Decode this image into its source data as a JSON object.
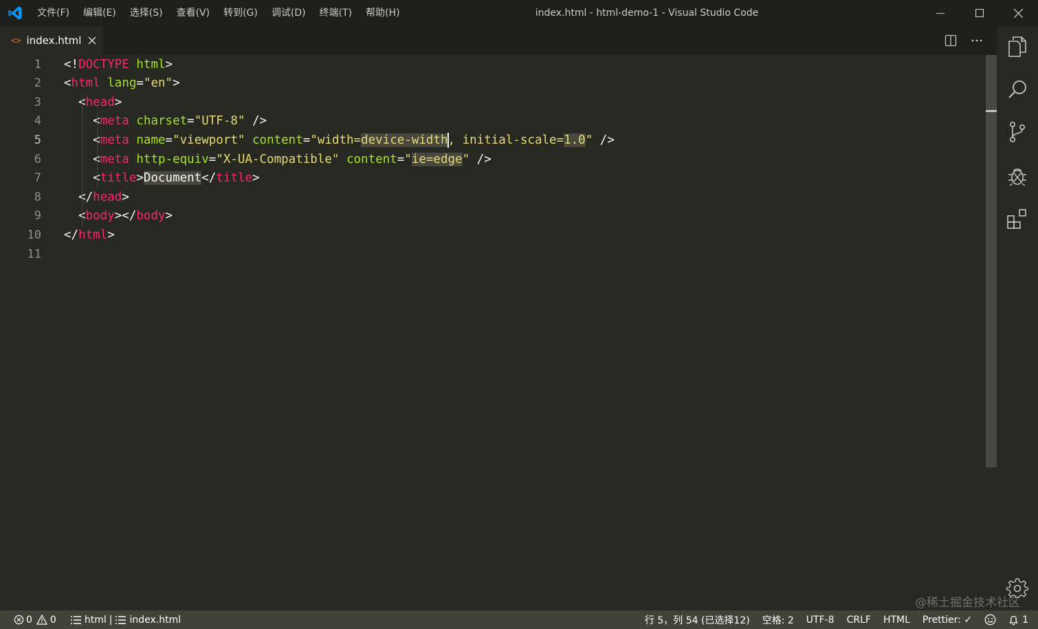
{
  "window": {
    "title": "index.html - html-demo-1 - Visual Studio Code",
    "logo_icon": "vscode-logo-icon",
    "accent": "#0098ff",
    "controls": [
      "minimize-icon",
      "maximize-icon",
      "close-icon"
    ]
  },
  "menu": [
    "文件(F)",
    "编辑(E)",
    "选择(S)",
    "查看(V)",
    "转到(G)",
    "调试(D)",
    "终端(T)",
    "帮助(H)"
  ],
  "tabs": [
    {
      "label": "index.html",
      "icon": "html-file-icon",
      "icon_glyph": "<>",
      "active": true,
      "close_icon": "close-icon"
    }
  ],
  "editor_actions": [
    "split-editor-icon",
    "more-actions-icon"
  ],
  "editor": {
    "active_line": 5,
    "line_numbers": [
      "1",
      "2",
      "3",
      "4",
      "5",
      "6",
      "7",
      "8",
      "9",
      "10",
      "11"
    ],
    "lines": [
      [
        [
          "p",
          "<!"
        ],
        [
          "tag",
          "DOCTYPE"
        ],
        [
          "p",
          " "
        ],
        [
          "attr",
          "html"
        ],
        [
          "p",
          ">"
        ]
      ],
      [
        [
          "p",
          "<"
        ],
        [
          "tag",
          "html"
        ],
        [
          "p",
          " "
        ],
        [
          "attr",
          "lang"
        ],
        [
          "p",
          "="
        ],
        [
          "str",
          "\"en\""
        ],
        [
          "p",
          ">"
        ]
      ],
      [
        [
          "p",
          "  <"
        ],
        [
          "tag",
          "head"
        ],
        [
          "p",
          ">"
        ]
      ],
      [
        [
          "p",
          "    <"
        ],
        [
          "tag",
          "meta"
        ],
        [
          "p",
          " "
        ],
        [
          "attr",
          "charset"
        ],
        [
          "p",
          "="
        ],
        [
          "str",
          "\"UTF-8\""
        ],
        [
          "p",
          " />"
        ]
      ],
      [
        [
          "p",
          "    <"
        ],
        [
          "tag",
          "meta"
        ],
        [
          "p",
          " "
        ],
        [
          "attr",
          "name"
        ],
        [
          "p",
          "="
        ],
        [
          "str",
          "\"viewport\""
        ],
        [
          "p",
          " "
        ],
        [
          "attr",
          "content"
        ],
        [
          "p",
          "="
        ],
        [
          "str",
          "\"width="
        ],
        [
          "str_hl",
          "device-width"
        ],
        [
          "cursor",
          ""
        ],
        [
          "str",
          ", initial-scale="
        ],
        [
          "str_hl",
          "1.0"
        ],
        [
          "str",
          "\""
        ],
        [
          "p",
          " />"
        ]
      ],
      [
        [
          "p",
          "    <"
        ],
        [
          "tag",
          "meta"
        ],
        [
          "p",
          " "
        ],
        [
          "attr",
          "http-equiv"
        ],
        [
          "p",
          "="
        ],
        [
          "str",
          "\"X-UA-Compatible\""
        ],
        [
          "p",
          " "
        ],
        [
          "attr",
          "content"
        ],
        [
          "p",
          "="
        ],
        [
          "str",
          "\""
        ],
        [
          "str_hl",
          "ie=edge"
        ],
        [
          "str",
          "\""
        ],
        [
          "p",
          " />"
        ]
      ],
      [
        [
          "p",
          "    <"
        ],
        [
          "tag",
          "title"
        ],
        [
          "p",
          ">"
        ],
        [
          "txt_hl",
          "Document"
        ],
        [
          "p",
          "</"
        ],
        [
          "tag",
          "title"
        ],
        [
          "p",
          ">"
        ]
      ],
      [
        [
          "p",
          "  </"
        ],
        [
          "tag",
          "head"
        ],
        [
          "p",
          ">"
        ]
      ],
      [
        [
          "p",
          "  <"
        ],
        [
          "tag",
          "body"
        ],
        [
          "p",
          "></"
        ],
        [
          "tag",
          "body"
        ],
        [
          "p",
          ">"
        ]
      ],
      [
        [
          "p",
          "</"
        ],
        [
          "tag",
          "html"
        ],
        [
          "p",
          ">"
        ]
      ],
      []
    ]
  },
  "activity_bar": [
    "explorer-icon",
    "search-icon",
    "source-control-icon",
    "debug-icon",
    "extensions-icon"
  ],
  "settings_icon": "settings-gear-icon",
  "status_bar": {
    "errors": "0",
    "warnings": "0",
    "breadcrumb_language": "html",
    "breadcrumb_sep": "|",
    "breadcrumb_file": "index.html",
    "position": "行 5，列 54 (已选择12)",
    "indent": "空格: 2",
    "encoding": "UTF-8",
    "eol": "CRLF",
    "language": "HTML",
    "prettier": "Prettier: ✓",
    "feedback_icon": "smiley-icon",
    "notifications": "1",
    "colors": {
      "background": "#414339"
    }
  },
  "watermark": "@稀土掘金技术社区"
}
